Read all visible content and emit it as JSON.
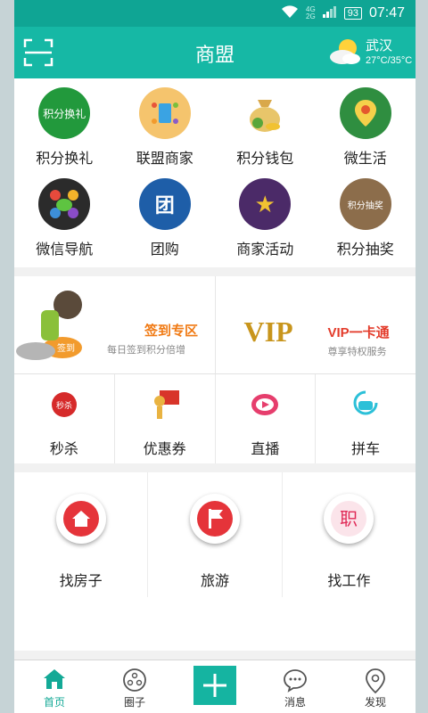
{
  "status": {
    "time": "07:47",
    "battery": "93",
    "net_top": "4G",
    "net_bottom": "2G"
  },
  "header": {
    "title": "商盟",
    "city": "武汉",
    "temp": "27°C/35°C"
  },
  "grid": [
    {
      "label": "积分换礼",
      "icon": "gift-exchange-icon",
      "color": "#1f9a3b",
      "text": "积分换礼"
    },
    {
      "label": "联盟商家",
      "icon": "merchant-alliance-icon",
      "color": "#f4c36c",
      "text": ""
    },
    {
      "label": "积分钱包",
      "icon": "money-bag-icon",
      "color": "#e9c36a",
      "text": ""
    },
    {
      "label": "微生活",
      "icon": "map-pin-leaf-icon",
      "color": "#2b8c3d",
      "text": ""
    },
    {
      "label": "微信导航",
      "icon": "wechat-hands-icon",
      "color": "#2b2b2b",
      "text": ""
    },
    {
      "label": "团购",
      "icon": "group-buy-icon",
      "color": "#1f5ea8",
      "text": "团"
    },
    {
      "label": "商家活动",
      "icon": "star-activity-icon",
      "color": "#4a2b68",
      "text": "★"
    },
    {
      "label": "积分抽奖",
      "icon": "lottery-icon",
      "color": "#8a6b4a",
      "text": "积分抽奖"
    }
  ],
  "promo": {
    "left": {
      "title": "签到专区",
      "subtitle": "每日签到积分倍增",
      "badge": "签到"
    },
    "right": {
      "title": "VIP一卡通",
      "subtitle": "尊享特权服务",
      "logo": "VIP"
    }
  },
  "quick": [
    {
      "label": "秒杀",
      "icon": "flash-sale-icon",
      "text": "秒杀"
    },
    {
      "label": "优惠券",
      "icon": "coupon-icon",
      "text": ""
    },
    {
      "label": "直播",
      "icon": "live-play-icon",
      "text": ""
    },
    {
      "label": "拼车",
      "icon": "carpool-icon",
      "text": ""
    }
  ],
  "services": [
    {
      "label": "找房子",
      "icon": "house-icon"
    },
    {
      "label": "旅游",
      "icon": "flag-icon"
    },
    {
      "label": "找工作",
      "icon": "job-icon",
      "text": "职"
    }
  ],
  "nav": [
    {
      "label": "首页",
      "icon": "home-icon"
    },
    {
      "label": "圈子",
      "icon": "circle-icon"
    },
    {
      "label": "",
      "icon": "add-icon"
    },
    {
      "label": "消息",
      "icon": "message-icon"
    },
    {
      "label": "发现",
      "icon": "discover-icon"
    }
  ]
}
